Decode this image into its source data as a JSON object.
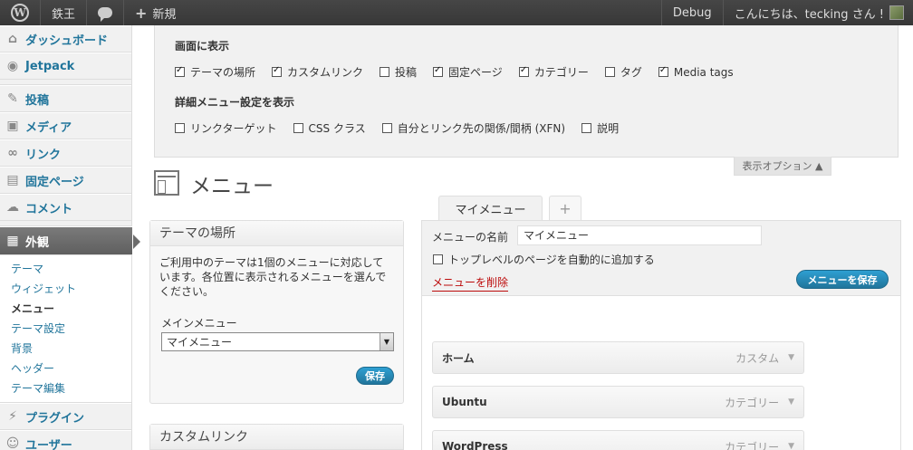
{
  "adminbar": {
    "site_name": "鉄王",
    "new_label": "新規",
    "debug_label": "Debug",
    "greeting": "こんにちは、tecking さん !"
  },
  "sidebar": {
    "items": [
      {
        "label": "ダッシュボード",
        "icon": "home-icon"
      },
      {
        "label": "Jetpack",
        "icon": "jetpack-icon"
      },
      {
        "label": "投稿",
        "icon": "pin-icon"
      },
      {
        "label": "メディア",
        "icon": "media-icon"
      },
      {
        "label": "リンク",
        "icon": "link-icon"
      },
      {
        "label": "固定ページ",
        "icon": "page-icon"
      },
      {
        "label": "コメント",
        "icon": "comment-icon"
      },
      {
        "label": "外観",
        "icon": "appearance-icon"
      },
      {
        "label": "プラグイン",
        "icon": "plugin-icon"
      },
      {
        "label": "ユーザー",
        "icon": "users-icon"
      }
    ],
    "submenu": [
      "テーマ",
      "ウィジェット",
      "メニュー",
      "テーマ設定",
      "背景",
      "ヘッダー",
      "テーマ編集"
    ]
  },
  "screen_options": {
    "show_title": "画面に表示",
    "show_items": [
      {
        "label": "テーマの場所",
        "checked": true
      },
      {
        "label": "カスタムリンク",
        "checked": true
      },
      {
        "label": "投稿",
        "checked": false
      },
      {
        "label": "固定ページ",
        "checked": true
      },
      {
        "label": "カテゴリー",
        "checked": true
      },
      {
        "label": "タグ",
        "checked": false
      },
      {
        "label": "Media tags",
        "checked": true
      }
    ],
    "advanced_title": "詳細メニュー設定を表示",
    "advanced_items": [
      {
        "label": "リンクターゲット",
        "checked": false
      },
      {
        "label": "CSS クラス",
        "checked": false
      },
      {
        "label": "自分とリンク先の関係/間柄 (XFN)",
        "checked": false
      },
      {
        "label": "説明",
        "checked": false
      }
    ],
    "tab_label": "表示オプション ▲"
  },
  "page": {
    "title": "メニュー"
  },
  "locations_box": {
    "title": "テーマの場所",
    "description": "ご利用中のテーマは1個のメニューに対応しています。各位置に表示されるメニューを選んでください。",
    "select_label": "メインメニュー",
    "selected": "マイメニュー",
    "save_label": "保存"
  },
  "custom_links_box": {
    "title": "カスタムリンク"
  },
  "tabs": {
    "active": "マイメニュー",
    "add": "+"
  },
  "menu_editor": {
    "name_label": "メニューの名前",
    "name_value": "マイメニュー",
    "autoadd_label": "トップレベルのページを自動的に追加する",
    "delete_label": "メニューを削除",
    "save_label": "メニューを保存",
    "items": [
      {
        "title": "ホーム",
        "type": "カスタム"
      },
      {
        "title": "Ubuntu",
        "type": "カテゴリー"
      },
      {
        "title": "WordPress",
        "type": "カテゴリー"
      }
    ]
  }
}
